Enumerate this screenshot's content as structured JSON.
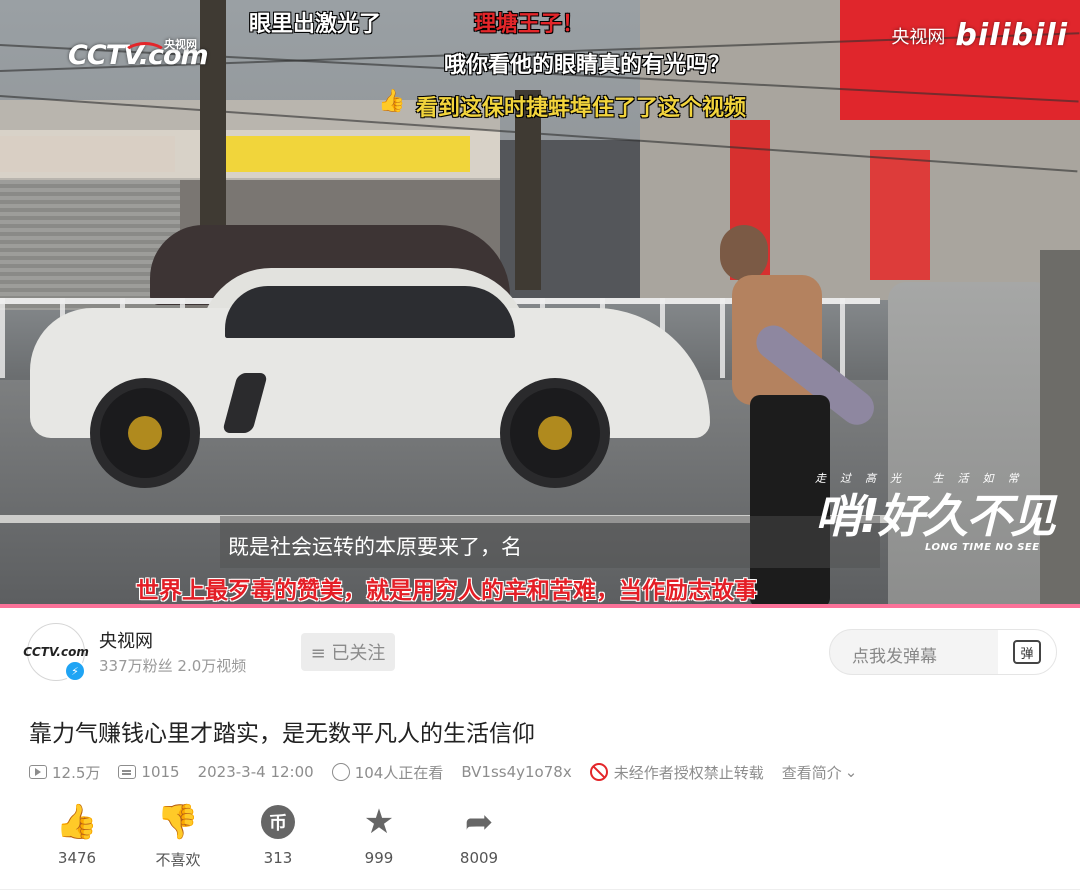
{
  "video": {
    "channel_logo": "CCTV.com",
    "channel_logo_cn": "央视网",
    "watermark_text": "央视网",
    "watermark_brand": "bilibili",
    "danmaku": [
      {
        "text": "眼里出激光了",
        "color": "#ffffff"
      },
      {
        "text": "理塘王子！",
        "color": "#e3262a"
      },
      {
        "text": "哦你看他的眼睛真的有光吗？",
        "color": "#ffffff"
      },
      {
        "text": "看到这保时捷蚌埠住了了这个视频",
        "color": "#f2d43c"
      }
    ],
    "subtitle_white": "既是社会运转的本原要来了，名",
    "subtitle_red": "世界上最歹毒的赞美，就是用穷人的辛和苦难，当作励志故事",
    "show_logo_top": "走过高光 生活如常",
    "show_logo_main": "哨!好久不见",
    "show_logo_en": "LONG TIME NO SEE",
    "progress": 1.0,
    "progress_color": "#fb7299"
  },
  "uploader": {
    "name": "央视网",
    "stats": "337万粉丝 2.0万视频",
    "follow_label": "≡ 已关注",
    "avatar_logo": "CCTV.com"
  },
  "danmu_input": {
    "placeholder": "点我发弹幕",
    "button_glyph": "弹"
  },
  "video_info": {
    "title": "靠力气赚钱心里才踏实，是无数平凡人的生活信仰",
    "views": "12.5万",
    "danmaku_count": "1015",
    "date": "2023-3-4  12:00",
    "watching": "104人正在看",
    "bvid": "BV1ss4y1o78x",
    "copyright": "未经作者授权禁止转载",
    "intro": "查看简介"
  },
  "actions": {
    "like": "3476",
    "dislike": "不喜欢",
    "coin": "313",
    "favorite": "999",
    "share": "8009"
  },
  "colors": {
    "accent": "#fb7299",
    "danger": "#e3262a",
    "verify": "#1fa4f4"
  }
}
